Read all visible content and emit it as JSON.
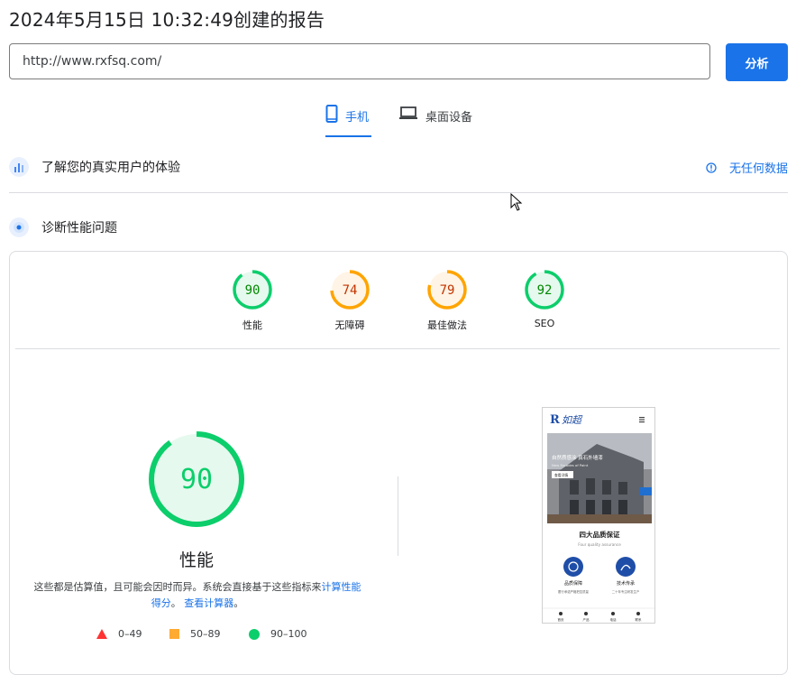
{
  "report_title": "2024年5月15日 10:32:49创建的报告",
  "url_input": {
    "value": "http://www.rxfsq.com/"
  },
  "analyze_button": "分析",
  "tabs": [
    {
      "label": "手机",
      "active": true,
      "icon": "smartphone-icon"
    },
    {
      "label": "桌面设备",
      "active": false,
      "icon": "laptop-icon"
    }
  ],
  "field_data": {
    "label": "了解您的真实用户的体验",
    "status": "无任何数据"
  },
  "diagnose": {
    "label": "诊断性能问题"
  },
  "scores": [
    {
      "value": "90",
      "label": "性能",
      "status": "pass"
    },
    {
      "value": "74",
      "label": "无障碍",
      "status": "average"
    },
    {
      "value": "79",
      "label": "最佳做法",
      "status": "average"
    },
    {
      "value": "92",
      "label": "SEO",
      "status": "pass"
    }
  ],
  "main_score": {
    "value": "90",
    "label": "性能"
  },
  "description": {
    "text": "这些都是估算值，且可能会因时而异。系统会直接基于这些指标来",
    "link1": "计算性能得分",
    "sep": "。",
    "link2": "查看计算器",
    "end": "。"
  },
  "legend": [
    {
      "range": "0–49",
      "shape": "triangle",
      "color": "#ff3333"
    },
    {
      "range": "50–89",
      "shape": "square",
      "color": "#ffaa33"
    },
    {
      "range": "90–100",
      "shape": "circle",
      "color": "#0cce6b"
    }
  ],
  "colors": {
    "accent": "#1a73e8",
    "pass": "#0cce6b",
    "average": "#ffa400",
    "fail": "#ff3333"
  },
  "screenshot": {
    "brand": "如超",
    "hero_line1": "自然质感涂 真石外墙漆",
    "hero_line2": "New Facades of Paint",
    "hero_button": "查看详情",
    "section_title": "四大品质保证",
    "section_sub": "Four quality assurance",
    "card1_title": "品质保障",
    "card1_text": "履行承诺严格把控质量",
    "card2_title": "技术传承",
    "card2_text": "二十年专注研发生产",
    "nav": [
      "首页",
      "产品",
      "电话",
      "联系"
    ]
  }
}
